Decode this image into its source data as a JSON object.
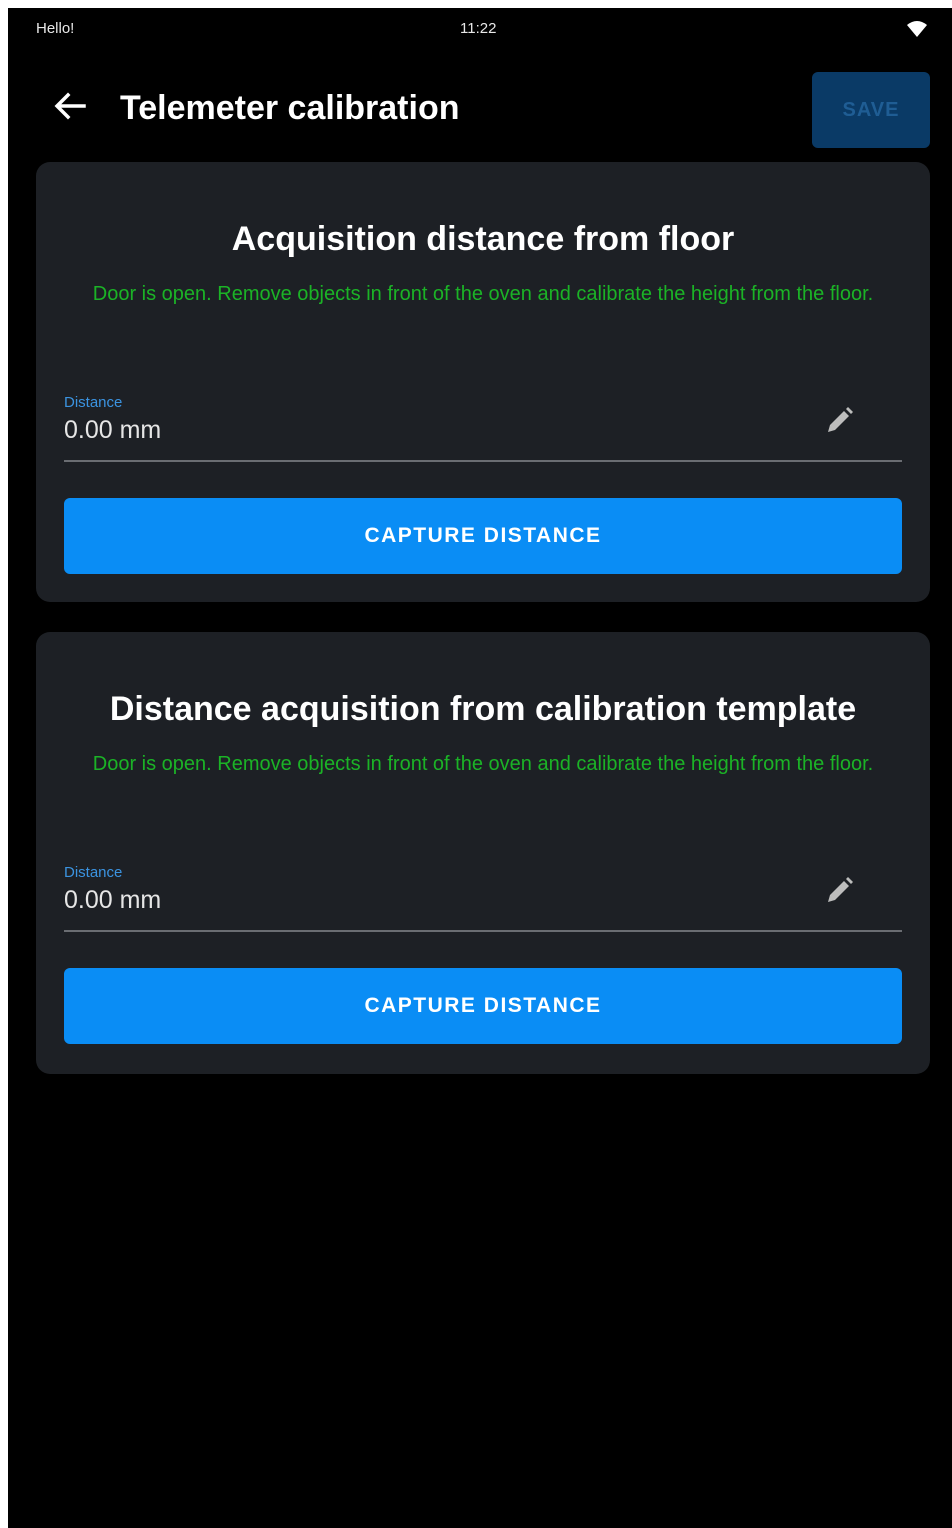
{
  "status_bar": {
    "left_text": "Hello!",
    "time": "11:22",
    "wifi_icon": "wifi-icon"
  },
  "app_bar": {
    "back_icon": "arrow-left-icon",
    "title": "Telemeter calibration",
    "save_label": "SAVE"
  },
  "colors": {
    "background": "#000000",
    "card": "#1d2025",
    "accent": "#0a8df5",
    "message": "#1bb326",
    "label": "#3b93e0",
    "save_disabled": "#0a3a66"
  },
  "cards": [
    {
      "title": "Acquisition distance from floor",
      "message": "Door is open. Remove objects in front of the oven and calibrate the height from the floor.",
      "field": {
        "label": "Distance",
        "value": "0.00 mm",
        "icon": "pencil-icon"
      },
      "button_label": "CAPTURE DISTANCE"
    },
    {
      "title": "Distance acquisition from calibration template",
      "message": "Door is open. Remove objects in front of the oven and calibrate the height from the floor.",
      "field": {
        "label": "Distance",
        "value": "0.00 mm",
        "icon": "pencil-icon"
      },
      "button_label": "CAPTURE DISTANCE"
    }
  ]
}
